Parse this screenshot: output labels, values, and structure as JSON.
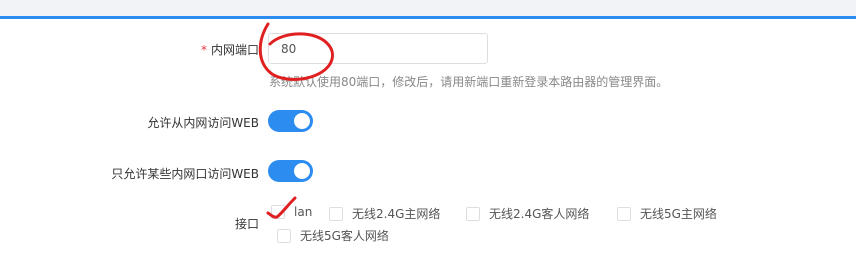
{
  "form": {
    "port": {
      "required_mark": "*",
      "label": "内网端口",
      "value": "80",
      "hint": "系统默认使用80端口，修改后，请用新端口重新登录本路由器的管理界面。"
    },
    "allow_lan_web": {
      "label": "允许从内网访问WEB",
      "enabled": true
    },
    "allow_some_lan_web": {
      "label": "只允许某些内网口访问WEB",
      "enabled": true
    },
    "interfaces": {
      "label": "接口",
      "options": [
        {
          "label": "lan",
          "checked": false
        },
        {
          "label": "无线2.4G主网络",
          "checked": false
        },
        {
          "label": "无线2.4G客人网络",
          "checked": false
        },
        {
          "label": "无线5G主网络",
          "checked": false
        },
        {
          "label": "无线5G客人网络",
          "checked": false
        }
      ]
    }
  },
  "colors": {
    "accent": "#2d8cf0",
    "required": "#e4393c",
    "annotation": "#e02020"
  }
}
